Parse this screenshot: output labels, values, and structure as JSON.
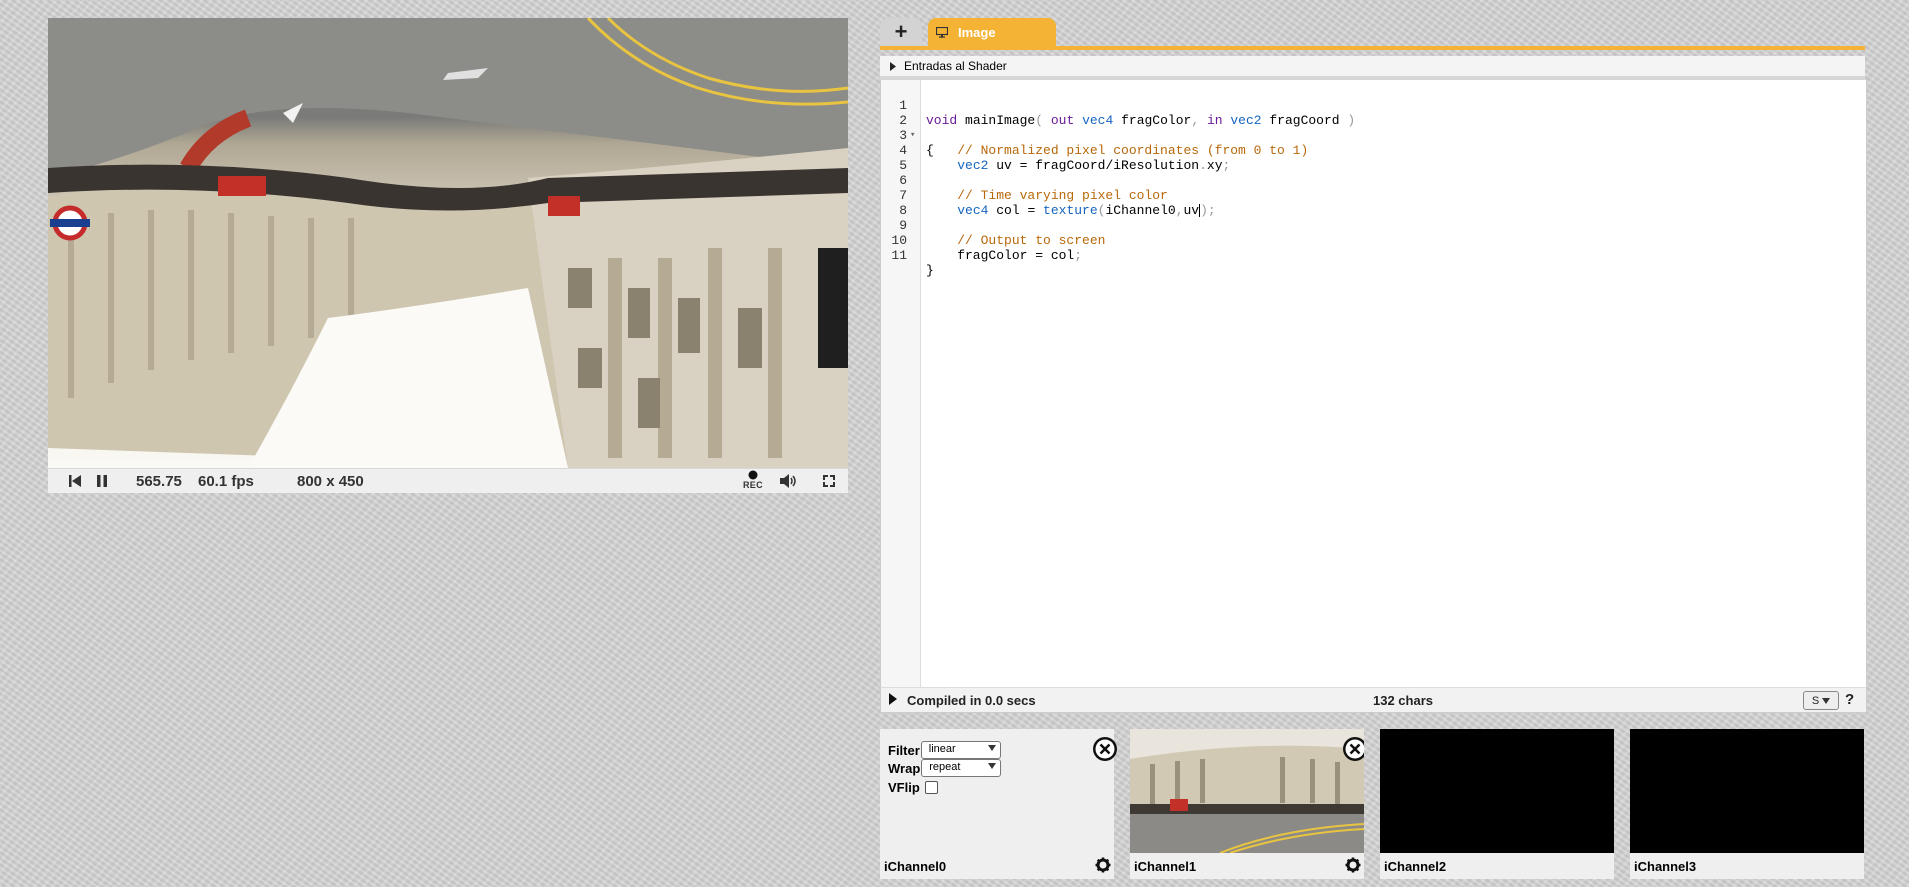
{
  "player": {
    "time": "565.75",
    "fps": "60.1 fps",
    "resolution": "800 x 450",
    "rec_label": "REC",
    "icons": [
      "rewind-icon",
      "pause-icon",
      "record-icon",
      "volume-icon",
      "fullscreen-icon"
    ]
  },
  "editor": {
    "tabs": [
      {
        "label": "+",
        "icon": "plus-icon"
      },
      {
        "label": "Image",
        "icon": "monitor-icon"
      }
    ],
    "inputs_header": "Entradas al Shader",
    "code_lines": [
      "void mainImage( out vec4 fragColor, in vec2 fragCoord )",
      "{",
      "    // Normalized pixel coordinates (from 0 to 1)",
      "    vec2 uv = fragCoord/iResolution.xy;",
      "",
      "    // Time varying pixel color",
      "    vec4 col = texture(iChannel0,uv);",
      "",
      "    // Output to screen",
      "    fragColor = col;",
      "}"
    ],
    "line_numbers": [
      "1",
      "2",
      "3",
      "4",
      "5",
      "6",
      "7",
      "8",
      "9",
      "10",
      "11"
    ],
    "status": {
      "compiled": "Compiled in 0.0 secs",
      "chars": "132 chars",
      "font_size": "S",
      "help": "?"
    }
  },
  "channels": [
    {
      "label": "iChannel0",
      "filter_label": "Filter",
      "filter_value": "linear",
      "wrap_label": "Wrap",
      "wrap_value": "repeat",
      "vflip_label": "VFlip",
      "vflip_checked": false
    },
    {
      "label": "iChannel1",
      "preview": "street-image"
    },
    {
      "label": "iChannel2",
      "preview": "empty"
    },
    {
      "label": "iChannel3",
      "preview": "empty"
    }
  ],
  "colors": {
    "accent": "#f5b335",
    "keyword": "#6a1b9a",
    "type": "#1565c0",
    "comment": "#b8680a"
  }
}
